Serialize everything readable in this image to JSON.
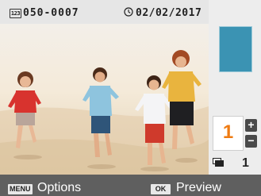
{
  "header": {
    "file_icon_text": "123",
    "file_number": "050-0007",
    "clock_icon": "clock-icon",
    "date": "02/02/2017"
  },
  "photo": {
    "description_icon": "photo-image"
  },
  "layout": {
    "thumb_color": "#3b93b3"
  },
  "copies": {
    "value": "1",
    "plus": "+",
    "minus": "−",
    "accent": "#ef7b12"
  },
  "total": {
    "icon": "stacked-pages-icon",
    "value": "1"
  },
  "bottom_bar": {
    "menu_badge": "MENU",
    "options_label": "Options",
    "ok_badge": "OK",
    "preview_label": "Preview"
  }
}
